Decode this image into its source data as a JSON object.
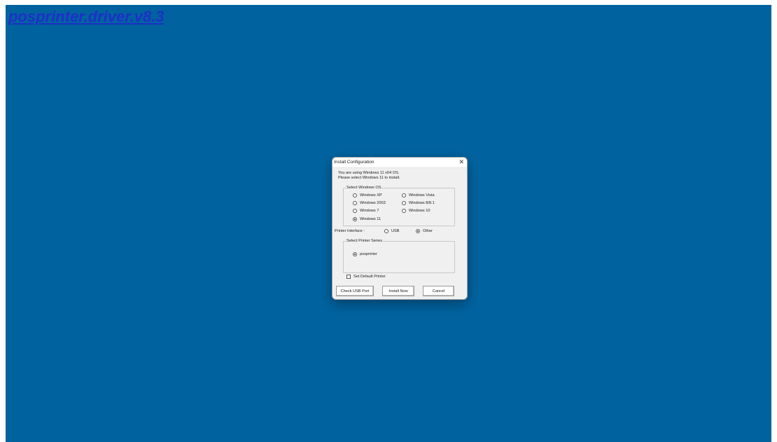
{
  "page": {
    "link_text": "posprinter.driver.v8.3",
    "background_color": "#0063a0",
    "link_color": "#1f2fc8"
  },
  "dialog": {
    "title": "Install Configuration",
    "close_glyph": "✕",
    "message_line1": "You are using Windows 11 x64 OS.",
    "message_line2": "Please select Windows 11 to install.",
    "os_group": {
      "legend": "Select Windows OS",
      "options": [
        {
          "label": "Windows XP",
          "selected": false
        },
        {
          "label": "Windows Vista",
          "selected": false
        },
        {
          "label": "Windows 2003",
          "selected": false
        },
        {
          "label": "Windows 8/8.1",
          "selected": false
        },
        {
          "label": "Windows 7",
          "selected": false
        },
        {
          "label": "Windows 10",
          "selected": false
        },
        {
          "label": "Windows 11",
          "selected": true
        }
      ]
    },
    "interface": {
      "label": "Printer Interface :",
      "options": [
        {
          "label": "USB",
          "selected": false
        },
        {
          "label": "Other",
          "selected": true
        }
      ]
    },
    "series_group": {
      "legend": "Select Printer Series",
      "options": [
        {
          "label": "posprinter",
          "selected": true
        }
      ]
    },
    "default_printer": {
      "label": "Set Default Printer",
      "checked": false
    },
    "buttons": {
      "check_usb": "Check USB Port",
      "install": "Install Now",
      "cancel": "Cancel"
    }
  }
}
